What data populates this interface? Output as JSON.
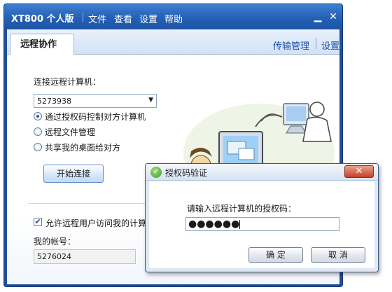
{
  "app": {
    "name": "XT800 个人版",
    "menu": [
      "文件",
      "查看",
      "设置",
      "帮助"
    ]
  },
  "tabs": {
    "active": "远程协作",
    "links": [
      "传输管理",
      "设置"
    ]
  },
  "remote": {
    "connect_label": "连接远程计算机：",
    "computer_id": "5273938",
    "options": [
      {
        "label": "通过授权码控制对方计算机",
        "selected": true
      },
      {
        "label": "远程文件管理",
        "selected": false
      },
      {
        "label": "共享我的桌面给对方",
        "selected": false
      }
    ],
    "connect_button": "开始连接"
  },
  "account": {
    "allow_label": "允许远程用户访问我的计算",
    "allow_checked": true,
    "my_account_label": "我的帐号：",
    "my_account_value": "5276024"
  },
  "dialog": {
    "title": "授权码验证",
    "prompt": "请输入远程计算机的授权码：",
    "masked_value": "●●●●●●",
    "ok_label": "确  定",
    "cancel_label": "取  消"
  },
  "colors": {
    "titlebar": "#2460b5",
    "link": "#1d4fa6",
    "dialog_icon": "#3c9c2c",
    "close_button": "#c6402a"
  }
}
